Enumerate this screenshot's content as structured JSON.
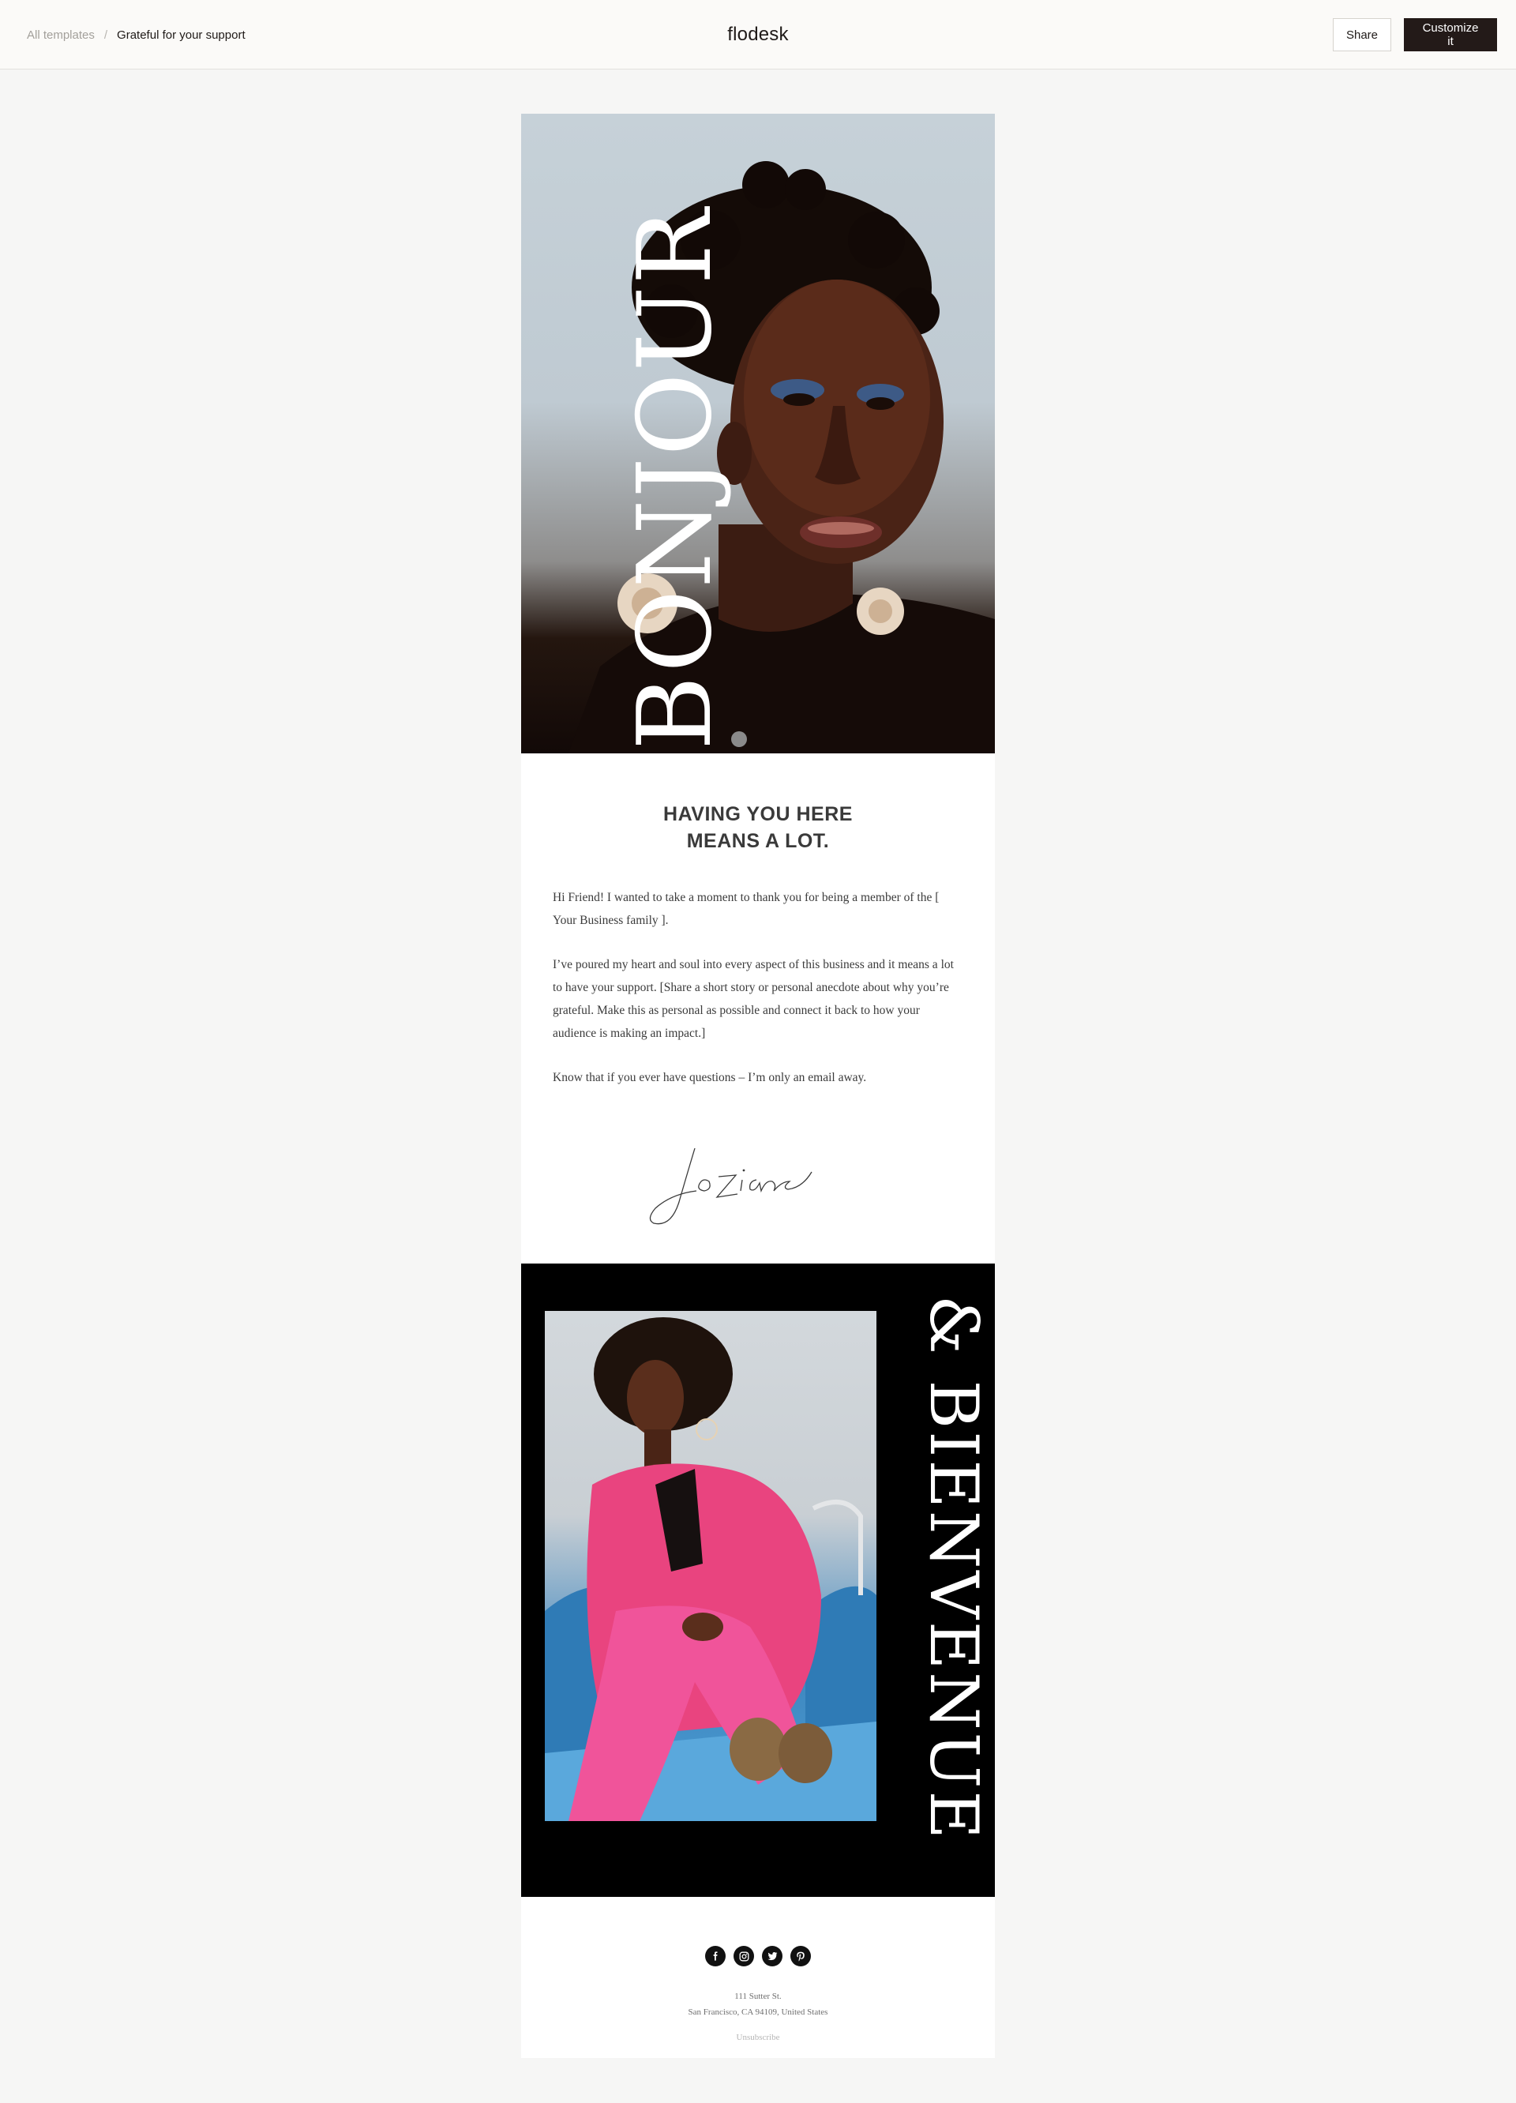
{
  "topbar": {
    "breadcrumb_link": "All templates",
    "breadcrumb_separator": "/",
    "breadcrumb_current": "Grateful for your support",
    "brand": "flodesk",
    "share_label": "Share",
    "customize_label": "Customize it"
  },
  "email": {
    "hero_word": "BONJOUR",
    "headline_line1": "HAVING YOU HERE",
    "headline_line2": "MEANS A LOT.",
    "paragraph1": "Hi Friend! I wanted to take a moment to thank you for being a member of the [ Your Business family ].",
    "paragraph2": "I’ve poured my heart and soul into every aspect of this business and it means a lot to have your support. [Share a short story or personal anecdote about why you’re grateful. Make this as personal as possible and connect it back to how your audience is making an impact.]",
    "paragraph3": "Know that if you ever have questions – I’m only an email away.",
    "signature": "josiane",
    "banner_word": "& BIENVENUE",
    "social_icons": [
      "facebook-icon",
      "instagram-icon",
      "twitter-icon",
      "pinterest-icon"
    ],
    "address_line1": "111 Sutter St.",
    "address_line2": "San Francisco, CA 94109, United States",
    "unsubscribe": "Unsubscribe"
  },
  "colors": {
    "page_bg": "#f6f6f5",
    "topbar_bg": "#fbfaf8",
    "primary_button": "#231a18",
    "banner_bg": "#000000",
    "hero_sky": "#c6d1d8",
    "suit_pink": "#e9447f",
    "seat_blue": "#3f88c0"
  }
}
